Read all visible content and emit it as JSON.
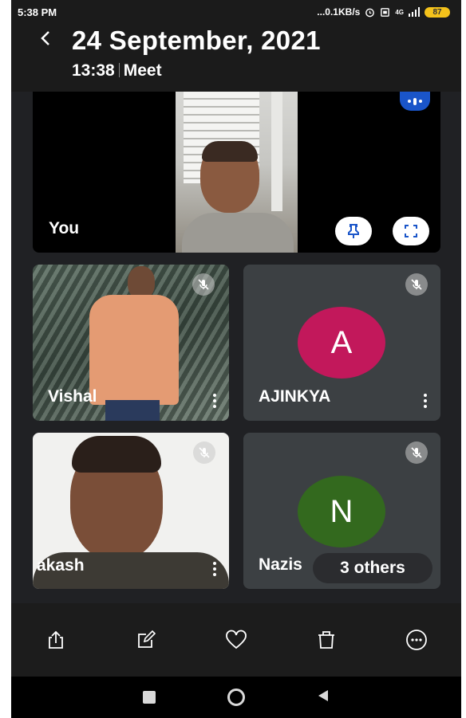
{
  "status_bar": {
    "time": "5:38 PM",
    "network_speed": "...0.1KB/s",
    "signal": "4G",
    "battery": "87"
  },
  "header": {
    "title": "24 September, 2021",
    "time": "13:38",
    "app": "Meet"
  },
  "tiles": {
    "self": {
      "name": "You"
    },
    "vishal": {
      "name": "Vishal"
    },
    "ajinkya": {
      "name": "AJINKYA",
      "initial": "A",
      "color": "#c2185b"
    },
    "akash": {
      "name": "akash"
    },
    "nazish": {
      "name": "Nazis",
      "initial": "N",
      "color": "#33691e",
      "others": "3 others"
    }
  },
  "toolbar": {
    "items": [
      "share-icon",
      "edit-icon",
      "favorite-icon",
      "delete-icon",
      "more-icon"
    ]
  },
  "navbar": {
    "items": [
      "recents-icon",
      "home-icon",
      "back-icon"
    ]
  }
}
